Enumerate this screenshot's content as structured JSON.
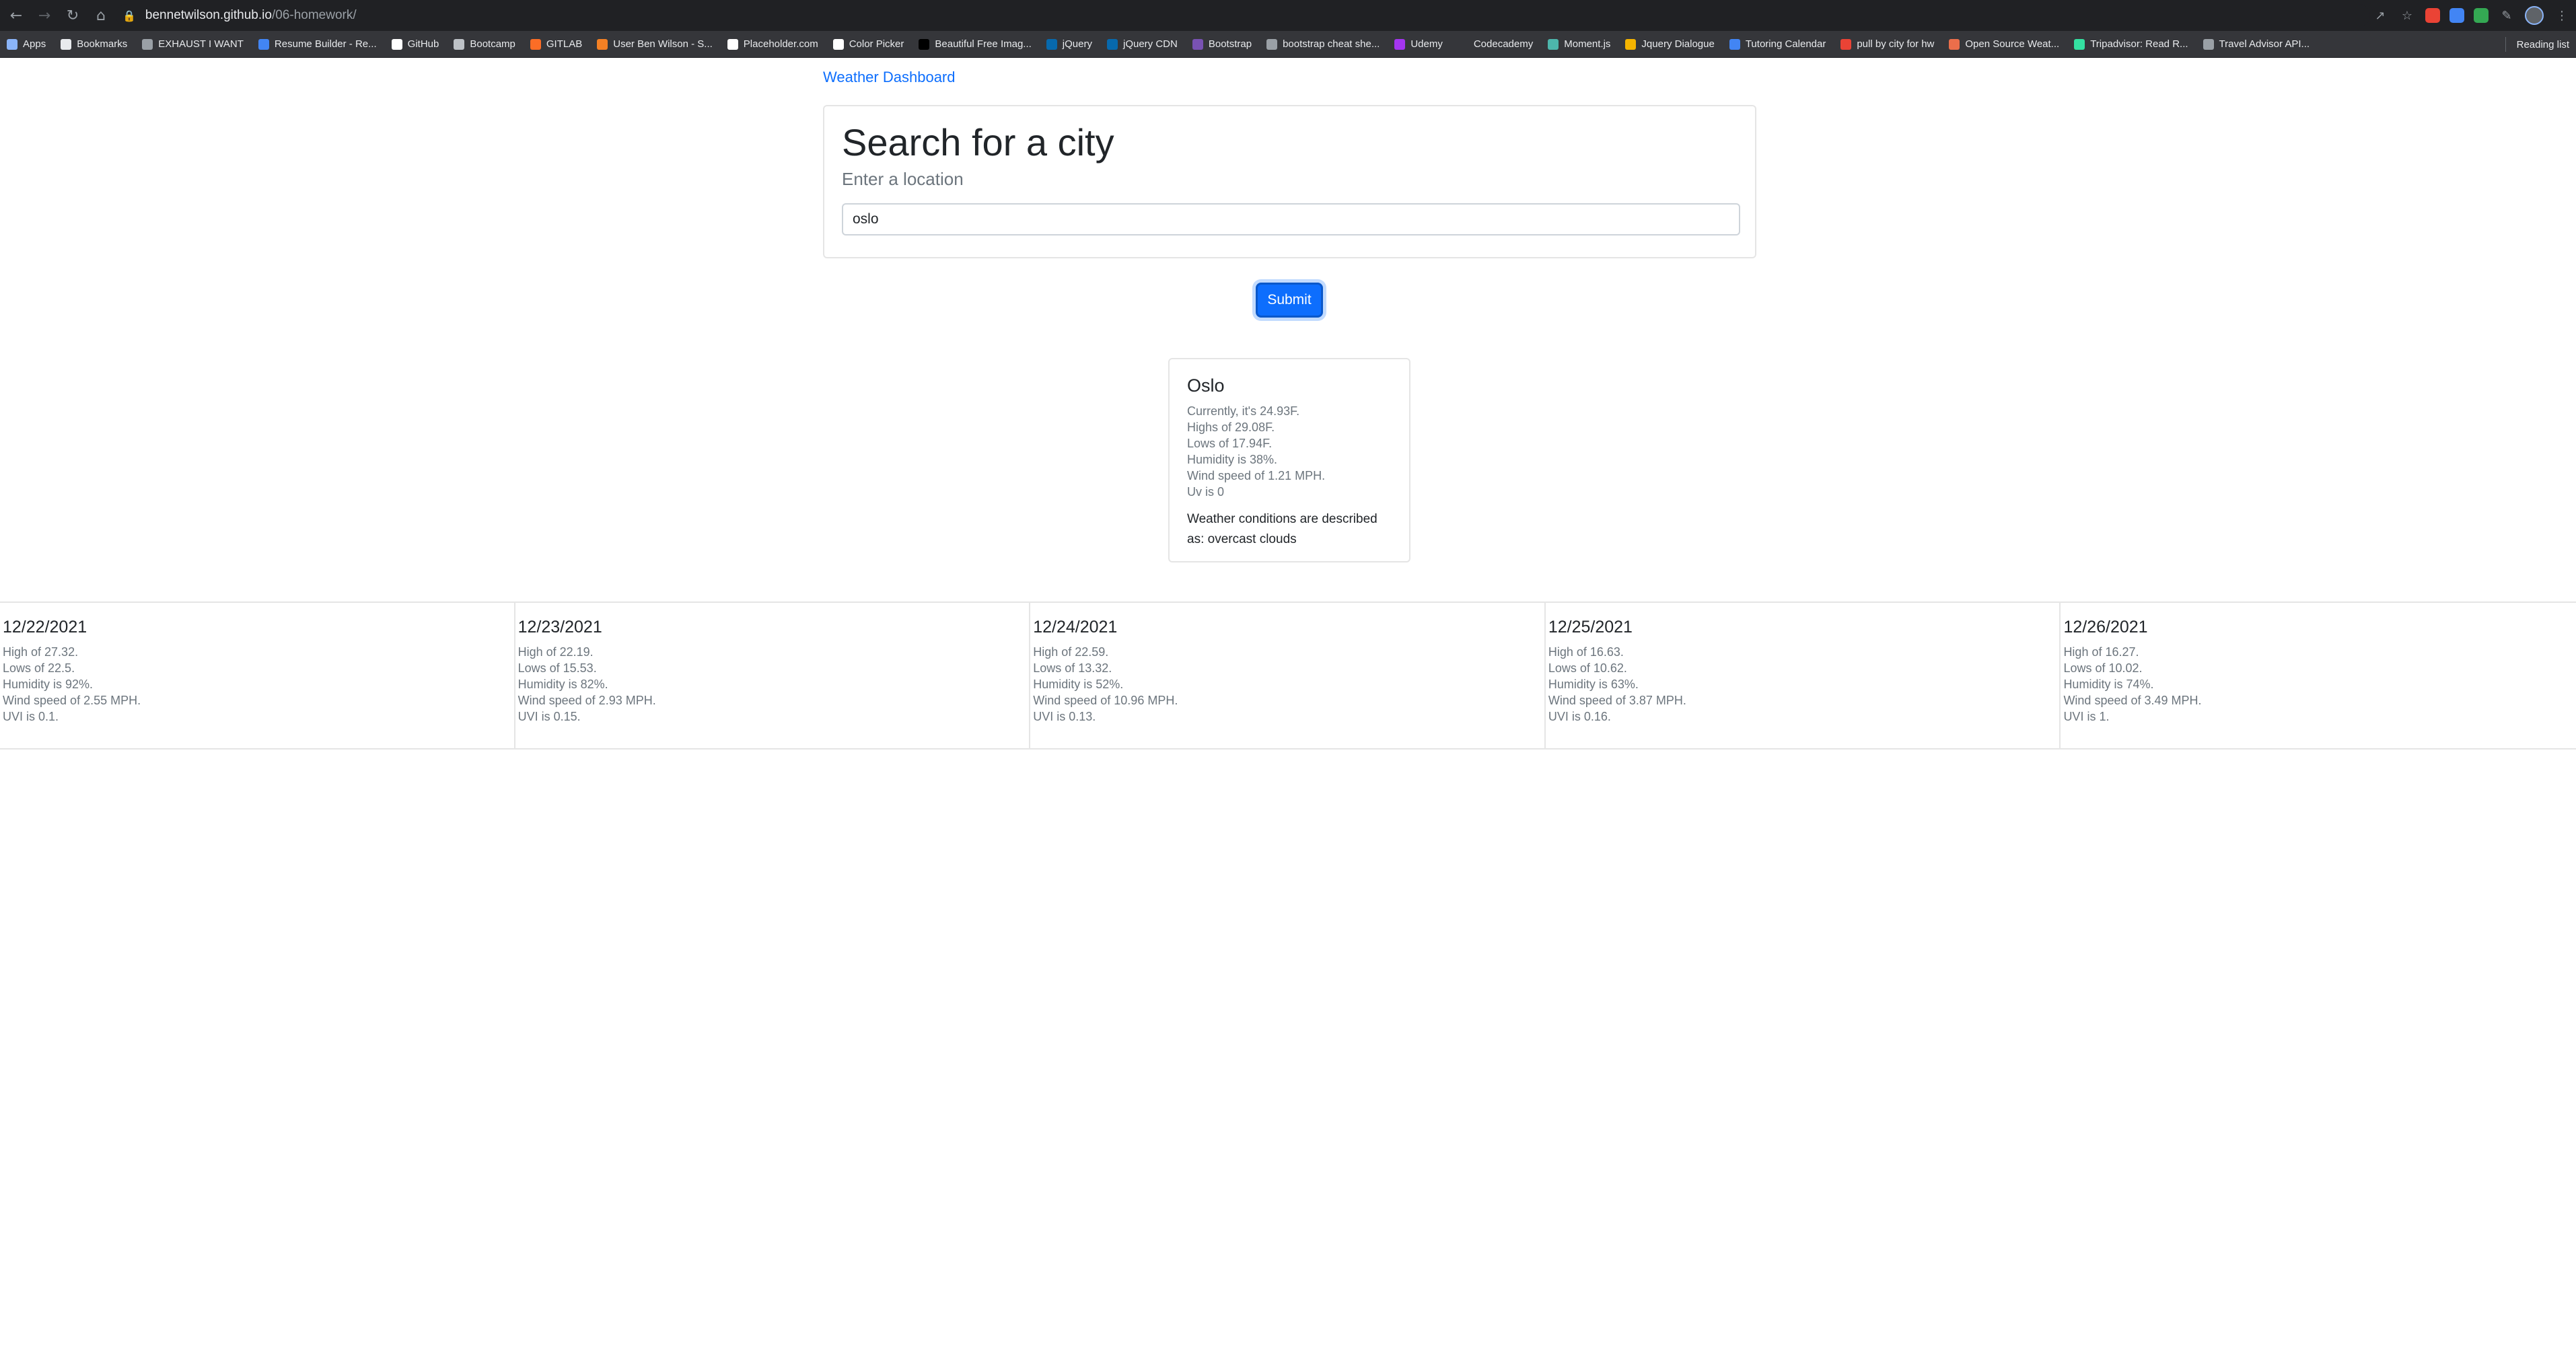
{
  "browser": {
    "url_host": "bennetwilson.github.io",
    "url_path": "/06-homework/",
    "bookmarks": [
      {
        "label": "Apps",
        "color": "#8ab4f8"
      },
      {
        "label": "Bookmarks",
        "color": "#e8eaed"
      },
      {
        "label": "EXHAUST I WANT",
        "color": "#9aa0a6"
      },
      {
        "label": "Resume Builder - Re...",
        "color": "#4285f4"
      },
      {
        "label": "GitHub",
        "color": "#ffffff"
      },
      {
        "label": "Bootcamp",
        "color": "#bdc1c6"
      },
      {
        "label": "GITLAB",
        "color": "#fc6d26"
      },
      {
        "label": "User Ben Wilson - S...",
        "color": "#f48024"
      },
      {
        "label": "Placeholder.com",
        "color": "#ffffff"
      },
      {
        "label": "Color Picker",
        "color": "#ffffff"
      },
      {
        "label": "Beautiful Free Imag...",
        "color": "#000000"
      },
      {
        "label": "jQuery",
        "color": "#0769ad"
      },
      {
        "label": "jQuery CDN",
        "color": "#0769ad"
      },
      {
        "label": "Bootstrap",
        "color": "#7952b3"
      },
      {
        "label": "bootstrap cheat she...",
        "color": "#9aa0a6"
      },
      {
        "label": "Udemy",
        "color": "#a435f0"
      },
      {
        "label": "Codecademy",
        "color": "#35363a"
      },
      {
        "label": "Moment.js",
        "color": "#4db6ac"
      },
      {
        "label": "Jquery Dialogue",
        "color": "#f4b400"
      },
      {
        "label": "Tutoring Calendar",
        "color": "#4285f4"
      },
      {
        "label": "pull by city for hw",
        "color": "#ea4335"
      },
      {
        "label": "Open Source Weat...",
        "color": "#eb6e4b"
      },
      {
        "label": "Tripadvisor: Read R...",
        "color": "#34e0a1"
      },
      {
        "label": "Travel Advisor API...",
        "color": "#9aa0a6"
      }
    ],
    "reading_list": "Reading list",
    "extension_colors": [
      "#ea4335",
      "#4285f4",
      "#34a853"
    ]
  },
  "page": {
    "brand": "Weather Dashboard",
    "search": {
      "title": "Search for a city",
      "subtitle": "Enter a location",
      "input_value": "oslo",
      "button": "Submit"
    },
    "current": {
      "city": "Oslo",
      "lines": [
        "Currently, it's 24.93F.",
        "Highs of 29.08F.",
        "Lows of 17.94F.",
        "Humidity is 38%.",
        "Wind speed of 1.21 MPH.",
        "Uv is 0"
      ],
      "description": "Weather conditions are described as: overcast clouds"
    },
    "forecast": [
      {
        "date": "12/22/2021",
        "lines": [
          "High of 27.32.",
          "Lows of 22.5.",
          "Humidity is 92%.",
          "Wind speed of 2.55 MPH.",
          "UVI is 0.1."
        ]
      },
      {
        "date": "12/23/2021",
        "lines": [
          "High of 22.19.",
          "Lows of 15.53.",
          "Humidity is 82%.",
          "Wind speed of 2.93 MPH.",
          "UVI is 0.15."
        ]
      },
      {
        "date": "12/24/2021",
        "lines": [
          "High of 22.59.",
          "Lows of 13.32.",
          "Humidity is 52%.",
          "Wind speed of 10.96 MPH.",
          "UVI is 0.13."
        ]
      },
      {
        "date": "12/25/2021",
        "lines": [
          "High of 16.63.",
          "Lows of 10.62.",
          "Humidity is 63%.",
          "Wind speed of 3.87 MPH.",
          "UVI is 0.16."
        ]
      },
      {
        "date": "12/26/2021",
        "lines": [
          "High of 16.27.",
          "Lows of 10.02.",
          "Humidity is 74%.",
          "Wind speed of 3.49 MPH.",
          "UVI is 1."
        ]
      }
    ]
  }
}
